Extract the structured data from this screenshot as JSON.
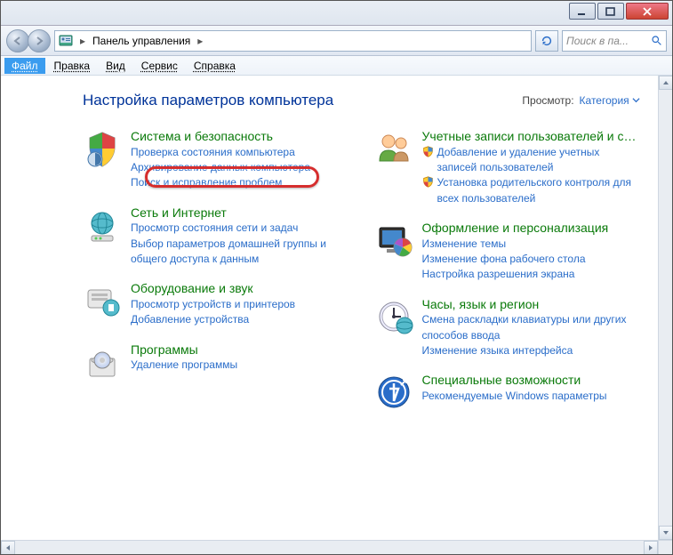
{
  "breadcrumb": {
    "label": "Панель управления"
  },
  "search": {
    "placeholder": "Поиск в па..."
  },
  "menu": {
    "file": "Файл",
    "edit": "Правка",
    "view": "Вид",
    "tools": "Сервис",
    "help": "Справка"
  },
  "page": {
    "title": "Настройка параметров компьютера",
    "viewby_label": "Просмотр:",
    "viewby_value": "Категория"
  },
  "left": [
    {
      "title": "Система и безопасность",
      "links": [
        {
          "text": "Проверка состояния компьютера"
        },
        {
          "text": "Архивирование данных компьютера"
        },
        {
          "text": "Поиск и исправление проблем"
        }
      ]
    },
    {
      "title": "Сеть и Интернет",
      "links": [
        {
          "text": "Просмотр состояния сети и задач"
        },
        {
          "text": "Выбор параметров домашней группы и общего доступа к данным"
        }
      ]
    },
    {
      "title": "Оборудование и звук",
      "links": [
        {
          "text": "Просмотр устройств и принтеров"
        },
        {
          "text": "Добавление устройства"
        }
      ]
    },
    {
      "title": "Программы",
      "links": [
        {
          "text": "Удаление программы"
        }
      ]
    }
  ],
  "right": [
    {
      "title": "Учетные записи пользователей и семейн…",
      "links": [
        {
          "text": "Добавление и удаление учетных записей пользователей",
          "shield": true
        },
        {
          "text": "Установка родительского контроля для всех пользователей",
          "shield": true
        }
      ]
    },
    {
      "title": "Оформление и персонализация",
      "links": [
        {
          "text": "Изменение темы"
        },
        {
          "text": "Изменение фона рабочего стола"
        },
        {
          "text": "Настройка разрешения экрана"
        }
      ]
    },
    {
      "title": "Часы, язык и регион",
      "links": [
        {
          "text": "Смена раскладки клавиатуры или других способов ввода"
        },
        {
          "text": "Изменение языка интерфейса"
        }
      ]
    },
    {
      "title": "Специальные возможности",
      "links": [
        {
          "text": "Рекомендуемые Windows параметры"
        }
      ]
    }
  ]
}
